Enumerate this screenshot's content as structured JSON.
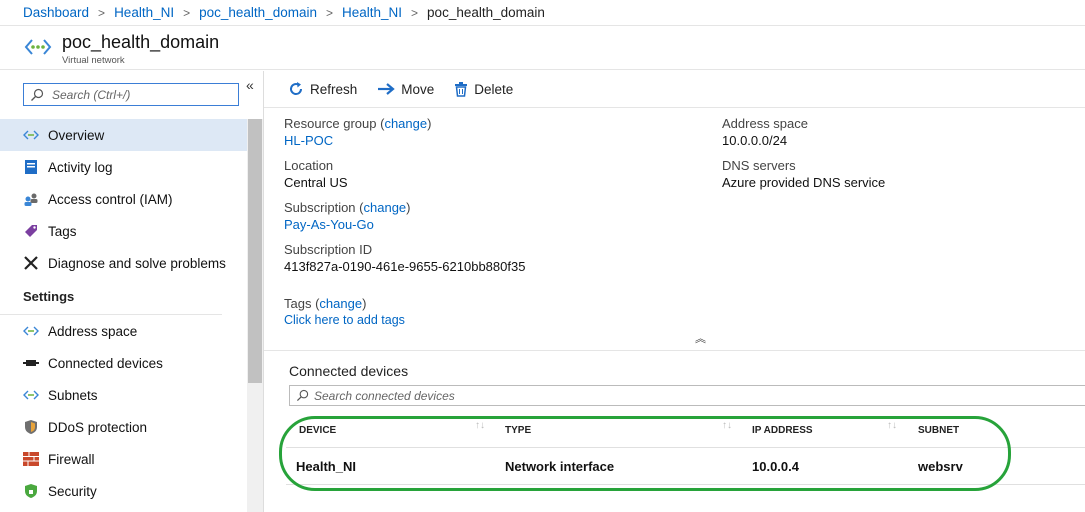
{
  "breadcrumb": {
    "items": [
      "Dashboard",
      "Health_NI",
      "poc_health_domain",
      "Health_NI"
    ],
    "current": "poc_health_domain"
  },
  "header": {
    "title": "poc_health_domain",
    "subtitle": "Virtual network",
    "icon": "vnet-icon"
  },
  "sidebar": {
    "search_placeholder": "Search (Ctrl+/)",
    "collapse_glyph": "«",
    "items": [
      {
        "label": "Overview",
        "icon": "overview-icon",
        "active": true
      },
      {
        "label": "Activity log",
        "icon": "activity-log-icon"
      },
      {
        "label": "Access control (IAM)",
        "icon": "iam-icon"
      },
      {
        "label": "Tags",
        "icon": "tag-icon"
      },
      {
        "label": "Diagnose and solve problems",
        "icon": "tools-icon"
      }
    ],
    "settings_heading": "Settings",
    "settings_items": [
      {
        "label": "Address space",
        "icon": "address-space-icon"
      },
      {
        "label": "Connected devices",
        "icon": "connected-devices-icon"
      },
      {
        "label": "Subnets",
        "icon": "subnets-icon"
      },
      {
        "label": "DDoS protection",
        "icon": "shield-icon"
      },
      {
        "label": "Firewall",
        "icon": "firewall-icon"
      },
      {
        "label": "Security",
        "icon": "security-icon"
      }
    ]
  },
  "toolbar": {
    "refresh": "Refresh",
    "move": "Move",
    "delete": "Delete"
  },
  "essentials": {
    "left": {
      "resource_group_label": "Resource group",
      "change": "change",
      "resource_group_value": "HL-POC",
      "location_label": "Location",
      "location_value": "Central US",
      "subscription_label": "Subscription",
      "subscription_value": "Pay-As-You-Go",
      "subscription_id_label": "Subscription ID",
      "subscription_id_value": "413f827a-0190-461e-9655-6210bb880f35",
      "tags_label": "Tags",
      "tags_link": "Click here to add tags"
    },
    "right": {
      "address_space_label": "Address space",
      "address_space_value": "10.0.0.0/24",
      "dns_label": "DNS servers",
      "dns_value": "Azure provided DNS service"
    },
    "collapse_glyph": "︽"
  },
  "devices": {
    "title": "Connected devices",
    "search_placeholder": "Search connected devices",
    "columns": [
      "DEVICE",
      "TYPE",
      "IP ADDRESS",
      "SUBNET"
    ],
    "sort_glyph": "↑↓",
    "rows": [
      {
        "device": "Health_NI",
        "type": "Network interface",
        "ip": "10.0.0.4",
        "subnet": "websrv"
      }
    ],
    "highlight_color": "#27a33a"
  },
  "colors": {
    "link": "#0066c4",
    "active_nav_bg": "#dde8f5",
    "accent": "#3b7ed6"
  }
}
